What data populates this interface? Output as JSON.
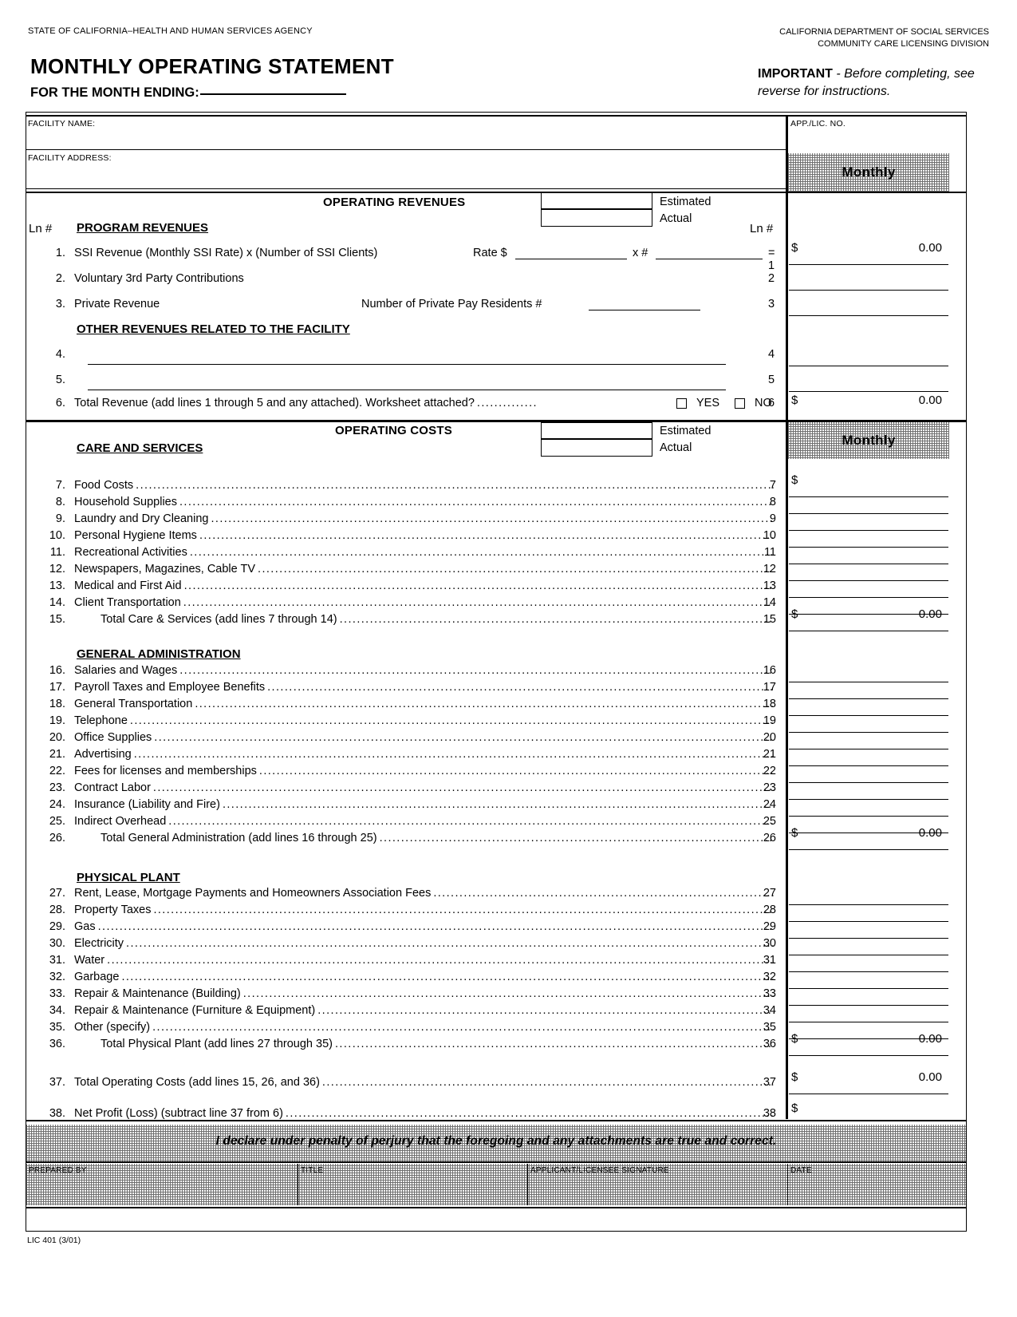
{
  "header": {
    "agency_left": "STATE OF CALIFORNIA–HEALTH AND HUMAN SERVICES AGENCY",
    "dept_line1": "CALIFORNIA DEPARTMENT OF SOCIAL SERVICES",
    "dept_line2": "COMMUNITY CARE LICENSING DIVISION",
    "title": "MONTHLY OPERATING STATEMENT",
    "month_ending_label": "FOR THE MONTH ENDING:",
    "important_strong": "IMPORTANT",
    "important_rest": " - Before completing, see reverse for instructions."
  },
  "facility": {
    "name_label": "FACILITY NAME:",
    "address_label": "FACILITY ADDRESS:",
    "app_lic_label": "APP./LIC. NO."
  },
  "columns": {
    "monthly_revenue": "Monthly",
    "monthly_costs": "Monthly"
  },
  "revenues": {
    "band_title": "OPERATING REVENUES",
    "estimated_label": "Estimated",
    "actual_label": "Actual",
    "ln_label": "Ln #",
    "ln_label_right": "Ln #",
    "program_heading": "PROGRAM REVENUES",
    "other_heading": "OTHER REVENUES RELATED TO THE FACILITY",
    "line1_text": "SSI Revenue (Monthly SSI Rate) x (Number of SSI Clients)",
    "line1_rate_label": "Rate $",
    "line1_times_label": "x #",
    "line1_equals_label": "= 1",
    "line3_private_label": "Number of Private Pay Residents #",
    "line6_yes": "YES",
    "line6_no": "NO",
    "items": [
      {
        "num": "1.",
        "label": "SSI Revenue (Monthly SSI Rate) x (Number of SSI Clients)",
        "ln": "1",
        "dollar": "$",
        "value": "0.00"
      },
      {
        "num": "2.",
        "label": "Voluntary 3rd Party Contributions",
        "ln": "2",
        "dollar": "",
        "value": ""
      },
      {
        "num": "3.",
        "label": "Private Revenue",
        "ln": "3",
        "dollar": "",
        "value": ""
      },
      {
        "num": "4.",
        "label": "",
        "ln": "4",
        "dollar": "",
        "value": ""
      },
      {
        "num": "5.",
        "label": "",
        "ln": "5",
        "dollar": "",
        "value": ""
      },
      {
        "num": "6.",
        "label": "Total Revenue (add lines 1 through 5 and any attached).  Worksheet attached?",
        "ln": "6",
        "dollar": "$",
        "value": "0.00"
      }
    ]
  },
  "costs": {
    "band_title": "OPERATING COSTS",
    "estimated_label": "Estimated",
    "actual_label": "Actual",
    "care_heading": "CARE AND SERVICES",
    "genadmin_heading": "GENERAL ADMINISTRATION",
    "physical_heading": "PHYSICAL PLANT",
    "items": [
      {
        "num": "7.",
        "label": "Food Costs",
        "ln": "7",
        "dollar": "$",
        "value": "",
        "indent": false
      },
      {
        "num": "8.",
        "label": "Household Supplies",
        "ln": "8",
        "dollar": "",
        "value": "",
        "indent": false
      },
      {
        "num": "9.",
        "label": "Laundry and Dry Cleaning",
        "ln": "9",
        "dollar": "",
        "value": "",
        "indent": false
      },
      {
        "num": "10.",
        "label": "Personal Hygiene Items",
        "ln": "10",
        "dollar": "",
        "value": "",
        "indent": false
      },
      {
        "num": "11.",
        "label": "Recreational Activities",
        "ln": "11",
        "dollar": "",
        "value": "",
        "indent": false
      },
      {
        "num": "12.",
        "label": "Newspapers, Magazines, Cable TV",
        "ln": "12",
        "dollar": "",
        "value": "",
        "indent": false
      },
      {
        "num": "13.",
        "label": "Medical and First Aid",
        "ln": "13",
        "dollar": "",
        "value": "",
        "indent": false
      },
      {
        "num": "14.",
        "label": "Client Transportation",
        "ln": "14",
        "dollar": "",
        "value": "",
        "indent": false
      },
      {
        "num": "15.",
        "label": "Total Care & Services (add lines 7 through 14)",
        "ln": "15",
        "dollar": "$",
        "value": "0.00",
        "indent": true
      },
      {
        "num": "16.",
        "label": "Salaries and Wages",
        "ln": "16",
        "dollar": "",
        "value": "",
        "indent": false
      },
      {
        "num": "17.",
        "label": "Payroll Taxes and Employee Benefits",
        "ln": "17",
        "dollar": "",
        "value": "",
        "indent": false
      },
      {
        "num": "18.",
        "label": "General Transportation",
        "ln": "18",
        "dollar": "",
        "value": "",
        "indent": false
      },
      {
        "num": "19.",
        "label": "Telephone",
        "ln": "19",
        "dollar": "",
        "value": "",
        "indent": false
      },
      {
        "num": "20.",
        "label": "Office Supplies",
        "ln": "20",
        "dollar": "",
        "value": "",
        "indent": false
      },
      {
        "num": "21.",
        "label": "Advertising",
        "ln": "21",
        "dollar": "",
        "value": "",
        "indent": false
      },
      {
        "num": "22.",
        "label": "Fees for licenses and memberships",
        "ln": "22",
        "dollar": "",
        "value": "",
        "indent": false
      },
      {
        "num": "23.",
        "label": "Contract Labor",
        "ln": "23",
        "dollar": "",
        "value": "",
        "indent": false
      },
      {
        "num": "24.",
        "label": "Insurance (Liability and Fire)",
        "ln": "24",
        "dollar": "",
        "value": "",
        "indent": false
      },
      {
        "num": "25.",
        "label": "Indirect Overhead",
        "ln": "25",
        "dollar": "",
        "value": "",
        "indent": false
      },
      {
        "num": "26.",
        "label": "Total General Administration (add lines 16 through 25)",
        "ln": "26",
        "dollar": "$",
        "value": "0.00",
        "indent": true
      },
      {
        "num": "27.",
        "label": "Rent, Lease, Mortgage Payments and Homeowners Association Fees",
        "ln": "27",
        "dollar": "",
        "value": "",
        "indent": false
      },
      {
        "num": "28.",
        "label": "Property Taxes",
        "ln": "28",
        "dollar": "",
        "value": "",
        "indent": false
      },
      {
        "num": "29.",
        "label": "Gas",
        "ln": "29",
        "dollar": "",
        "value": "",
        "indent": false
      },
      {
        "num": "30.",
        "label": "Electricity",
        "ln": "30",
        "dollar": "",
        "value": "",
        "indent": false
      },
      {
        "num": "31.",
        "label": "Water",
        "ln": "31",
        "dollar": "",
        "value": "",
        "indent": false
      },
      {
        "num": "32.",
        "label": "Garbage",
        "ln": "32",
        "dollar": "",
        "value": "",
        "indent": false
      },
      {
        "num": "33.",
        "label": "Repair & Maintenance (Building)",
        "ln": "33",
        "dollar": "",
        "value": "",
        "indent": false
      },
      {
        "num": "34.",
        "label": "Repair & Maintenance (Furniture & Equipment)",
        "ln": "34",
        "dollar": "",
        "value": "",
        "indent": false
      },
      {
        "num": "35.",
        "label": "Other (specify)",
        "ln": "35",
        "dollar": "",
        "value": "",
        "indent": false
      },
      {
        "num": "36.",
        "label": "Total Physical Plant (add lines 27 through 35)",
        "ln": "36",
        "dollar": "$",
        "value": "0.00",
        "indent": true
      },
      {
        "num": "37.",
        "label": "Total Operating Costs (add lines 15, 26, and 36)",
        "ln": "37",
        "dollar": "$",
        "value": "0.00",
        "indent": false
      },
      {
        "num": "38.",
        "label": "Net Profit (Loss) (subtract line 37 from 6)",
        "ln": "38",
        "dollar": "$",
        "value": "",
        "indent": false
      }
    ]
  },
  "declaration": {
    "text": "I declare under penalty of perjury that the foregoing and any attachments are true and correct.",
    "prepared_by_label": "PREPARED BY",
    "title_label": "TITLE",
    "signature_label": "APPLICANT/LICENSEE SIGNATURE",
    "date_label": "DATE"
  },
  "footer": {
    "form_code": "LIC 401 (3/01)"
  }
}
